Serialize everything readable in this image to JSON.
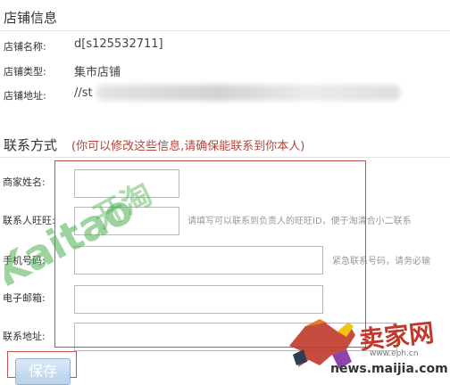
{
  "shop_info": {
    "title": "店铺信息",
    "rows": [
      {
        "label": "店铺名称:",
        "value": "d[s125532711]"
      },
      {
        "label": "店铺类型:",
        "value": "集市店铺"
      },
      {
        "label": "店铺地址:",
        "value": "//st"
      }
    ]
  },
  "contact": {
    "title": "联系方式",
    "hint": "(你可以修改这些信息,请确保能联系到你本人)",
    "fields": [
      {
        "label": "商家姓名:",
        "value": "",
        "hint": ""
      },
      {
        "label": "联系人旺旺:",
        "value": "",
        "hint": "请填写可以联系到负责人的旺旺ID，便于淘清合小二联系"
      },
      {
        "label": "手机号码:",
        "value": "",
        "hint": "紧急联系号码，请务必输"
      },
      {
        "label": "电子邮箱:",
        "value": "",
        "hint": ""
      },
      {
        "label": "联系地址:",
        "value": "",
        "hint": ""
      }
    ]
  },
  "save_label": "保存",
  "watermarks": {
    "kaitao": "Kaitao开淘",
    "site_cn": "卖家网",
    "site_url_small": "www.eph.cn",
    "site_url": "news.maijia.com"
  }
}
